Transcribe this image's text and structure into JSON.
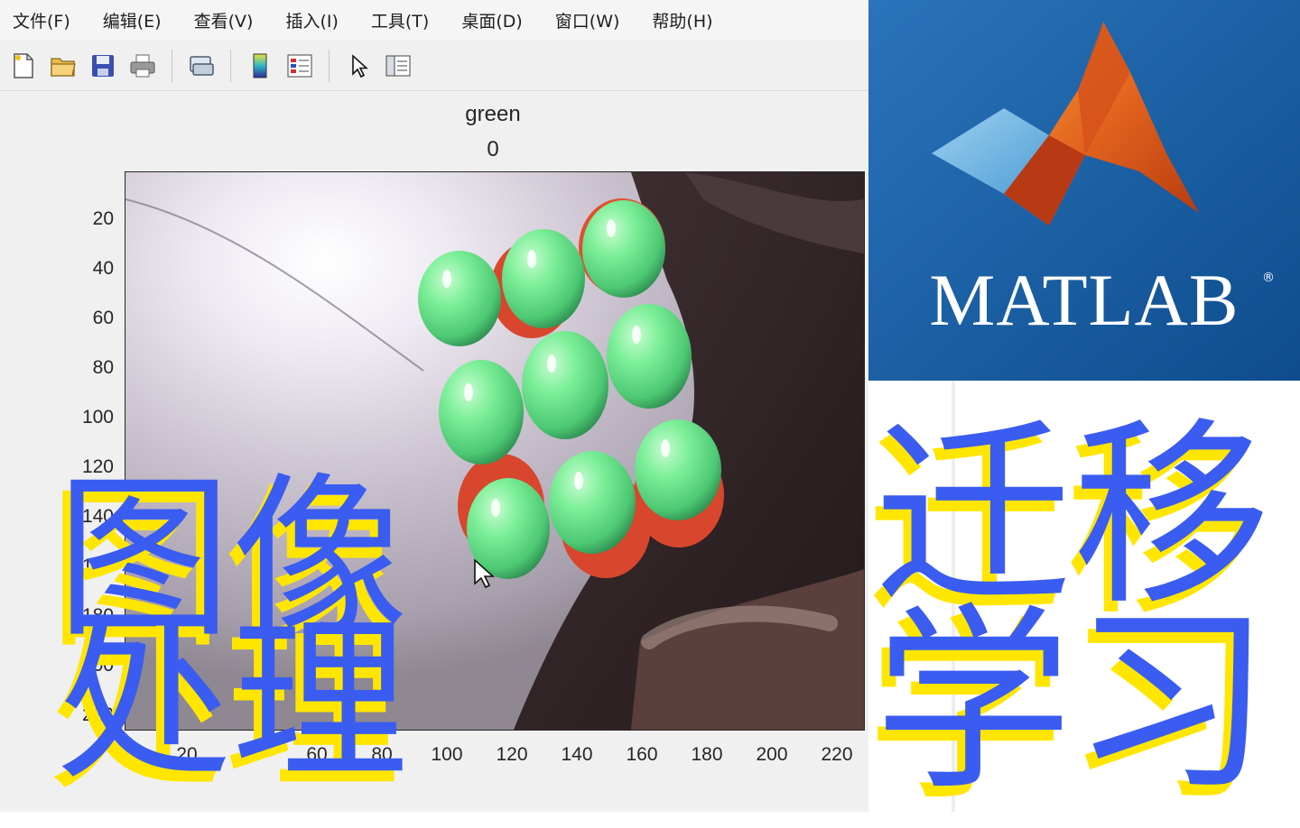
{
  "menu": [
    "文件(F)",
    "编辑(E)",
    "查看(V)",
    "插入(I)",
    "工具(T)",
    "桌面(D)",
    "窗口(W)",
    "帮助(H)"
  ],
  "toolbar": {
    "buttons": [
      "new-figure-icon",
      "open-file-icon",
      "save-icon",
      "print-icon",
      "link-plot-icon",
      "colorbar-icon",
      "legend-icon",
      "pointer-icon",
      "property-inspector-icon"
    ]
  },
  "plot": {
    "title": "green",
    "subtitle": "0",
    "yticks": [
      "20",
      "40",
      "60",
      "80",
      "100",
      "120",
      "140",
      "160",
      "180",
      "200",
      "220"
    ],
    "xticks": [
      "20",
      "40",
      "60",
      "80",
      "100",
      "120",
      "140",
      "160",
      "180",
      "200",
      "220"
    ]
  },
  "logo": {
    "wordmark": "MATLAB",
    "registered": "®",
    "background": "#1a5ea3"
  },
  "overlay": {
    "left_line1": "图像",
    "left_line2": "处理",
    "right_line1": "迁移",
    "right_line2": "学习",
    "fill_color": "#3a5cf0",
    "shadow_color": "#ffe600"
  }
}
